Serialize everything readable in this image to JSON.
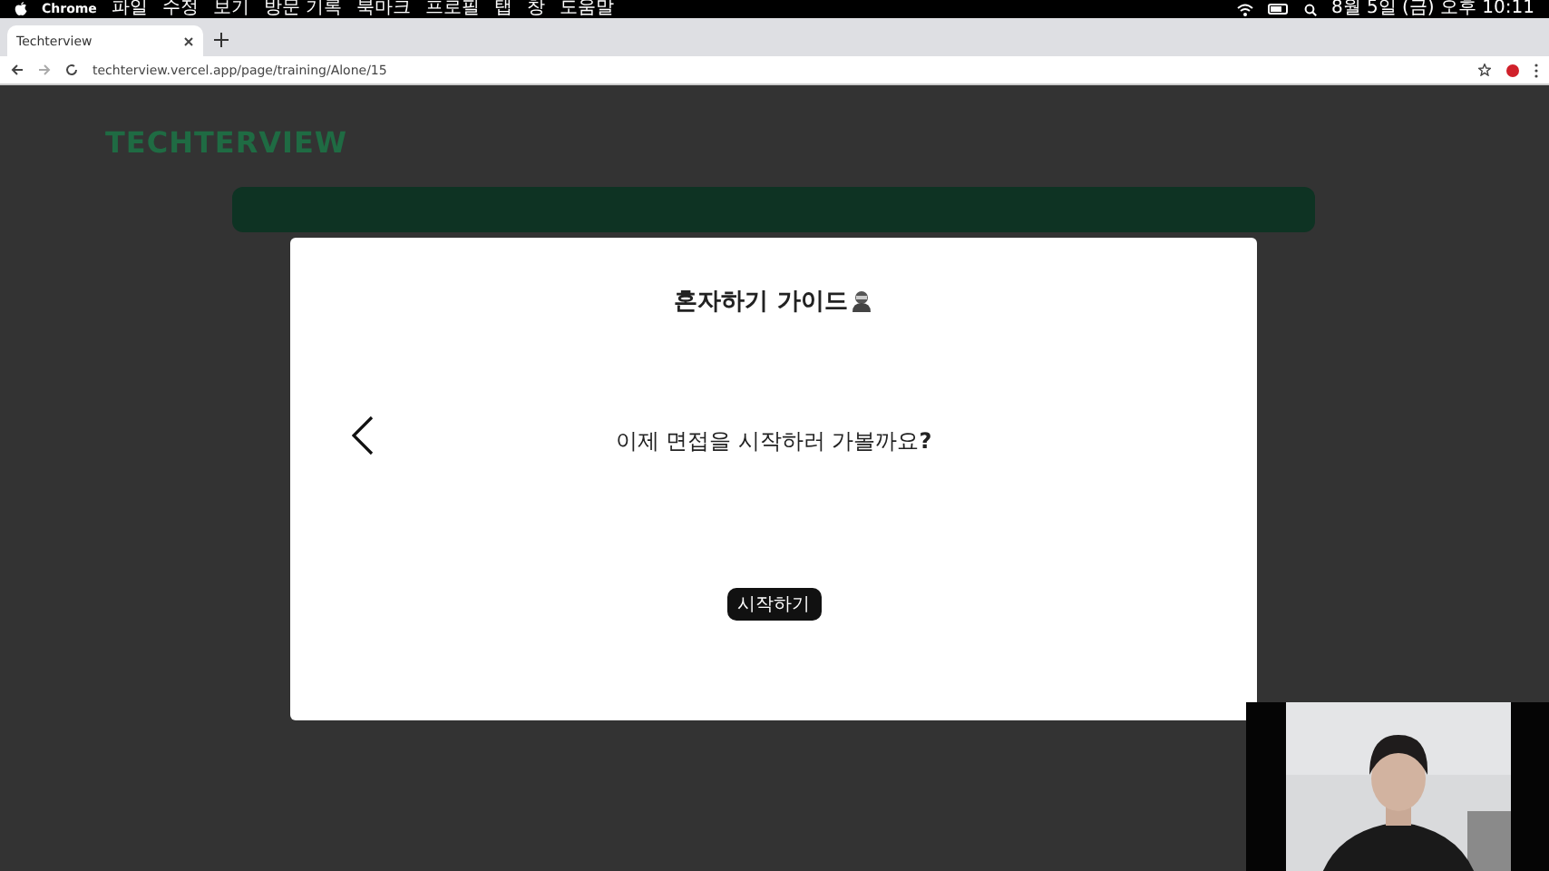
{
  "menu_bar": {
    "items": [
      "Chrome",
      "파일",
      "수정",
      "보기",
      "방문 기록",
      "북마크",
      "프로필",
      "탭",
      "창",
      "도움말"
    ],
    "clock": "8월 5일 (금) 오후 10:11"
  },
  "browser": {
    "tabs": [
      {
        "title": "Techterview",
        "selected": true
      }
    ],
    "url": "techterview.vercel.app/page/training/Alone/15"
  },
  "page": {
    "logo": "TECHTERVIEW"
  },
  "modal": {
    "title": "혼자하기 가이드",
    "message": "이제 면접을 시작하러 가볼까요**?**",
    "button": "시작하기"
  }
}
